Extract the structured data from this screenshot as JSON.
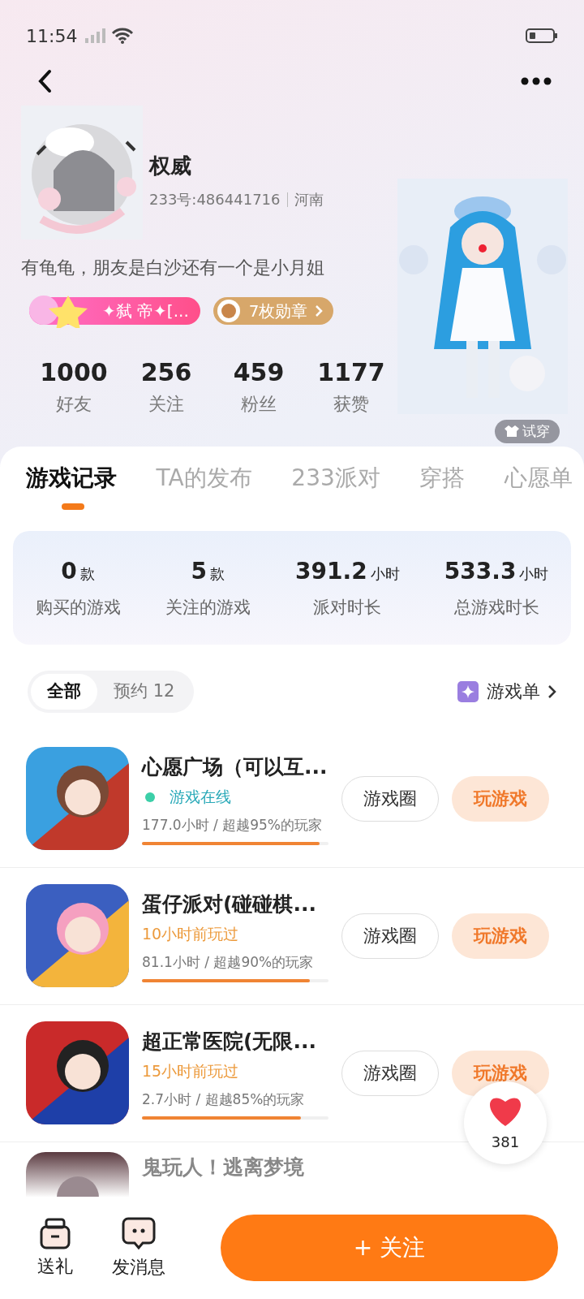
{
  "status_bar": {
    "time": "11:54"
  },
  "profile": {
    "name": "权威",
    "id_line": "233号:486441716",
    "region": "河南",
    "bio": "有龟龟，朋友是白沙还有一个是小月姐",
    "title_badge": "✦弑 帝✦[...",
    "medal_badge": "7枚勋章",
    "try_on": "试穿"
  },
  "stats": [
    {
      "value": "1000",
      "label": "好友"
    },
    {
      "value": "256",
      "label": "关注"
    },
    {
      "value": "459",
      "label": "粉丝"
    },
    {
      "value": "1177",
      "label": "获赞"
    }
  ],
  "tabs": [
    {
      "label": "游戏记录",
      "selected": true
    },
    {
      "label": "TA的发布",
      "selected": false
    },
    {
      "label": "233派对",
      "selected": false
    },
    {
      "label": "穿搭",
      "selected": false
    },
    {
      "label": "心愿单",
      "selected": false
    }
  ],
  "summary": [
    {
      "value": "0",
      "unit": "款",
      "label": "购买的游戏"
    },
    {
      "value": "5",
      "unit": "款",
      "label": "关注的游戏"
    },
    {
      "value": "391.2",
      "unit": "小时",
      "label": "派对时长"
    },
    {
      "value": "533.3",
      "unit": "小时",
      "label": "总游戏时长"
    }
  ],
  "filters": [
    {
      "label": "全部",
      "selected": true
    },
    {
      "label": "预约 12",
      "selected": false
    }
  ],
  "game_list_link": "游戏单",
  "games": [
    {
      "title": "心愿广场（可以互...",
      "status": "游戏在线",
      "kind": "online",
      "stats": "177.0小时 / 超越95%的玩家",
      "level": 0.95,
      "circle_button": "游戏圈",
      "play_button": "玩游戏"
    },
    {
      "title": "蛋仔派对(碰碰棋...",
      "status": "10小时前玩过",
      "kind": "recent",
      "stats": "81.1小时 / 超越90%的玩家",
      "level": 0.9,
      "circle_button": "游戏圈",
      "play_button": "玩游戏"
    },
    {
      "title": "超正常医院(无限...",
      "status": "15小时前玩过",
      "kind": "recent",
      "stats": "2.7小时 / 超越85%的玩家",
      "level": 0.85,
      "circle_button": "游戏圈",
      "play_button": "玩游戏"
    },
    {
      "title": "鬼玩人！逃离梦境",
      "kind": "partial"
    }
  ],
  "like_count": "381",
  "bottom_bar": {
    "gift": "送礼",
    "message": "发消息",
    "follow": "+ 关注"
  }
}
